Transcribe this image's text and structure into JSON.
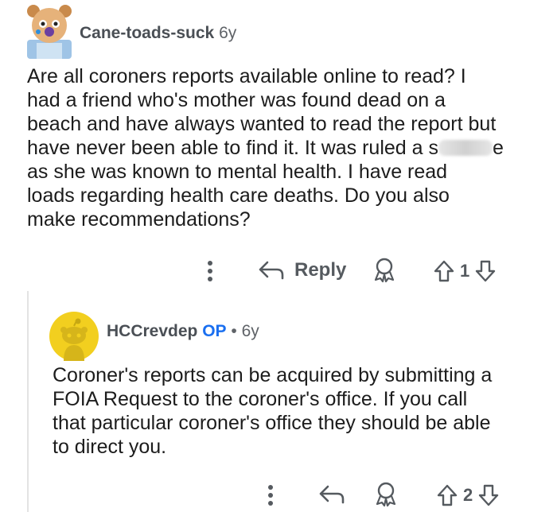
{
  "comment1": {
    "username": "Cane-toads-suck",
    "age": "6y",
    "text_lines": [
      "Are all coroners reports available online to read? I",
      "had a friend who's mother was found dead on a",
      "beach and have always wanted to read the report but",
      "have never been able to find it. It was ruled a s",
      "as she was known to mental health. I have read",
      "loads regarding health care deaths. Do you also",
      "make recommendations?"
    ],
    "redaction_tail": "e",
    "reply_label": "Reply",
    "vote_count": "1"
  },
  "comment2": {
    "username": "HCCrevdep",
    "op_badge": "OP",
    "separator": "•",
    "age": "6y",
    "text_lines": [
      "Coroner's reports can be acquired by submitting a",
      "FOIA Request to the coroner's office. If you call",
      "that particular coroner's office they should be able",
      "to direct you."
    ],
    "vote_count": "2"
  },
  "colors": {
    "op_blue": "#1a6ff0",
    "snoo_yellow": "#f2cf1f",
    "text": "#1c1c1c",
    "muted": "#5f6368"
  }
}
